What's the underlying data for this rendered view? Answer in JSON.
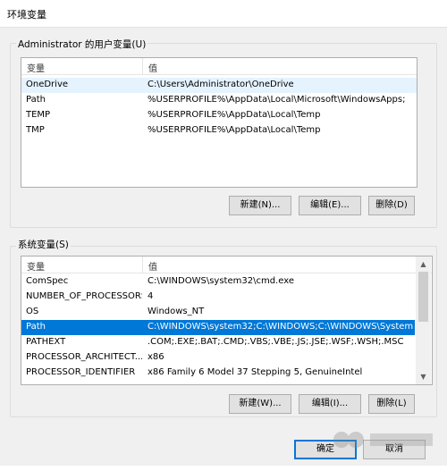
{
  "window": {
    "title": "环境变量"
  },
  "user_vars": {
    "label": "Administrator 的用户变量(U)",
    "columns": [
      "变量",
      "值"
    ],
    "rows": [
      {
        "name": "OneDrive",
        "value": "C:\\Users\\Administrator\\OneDrive"
      },
      {
        "name": "Path",
        "value": "%USERPROFILE%\\AppData\\Local\\Microsoft\\WindowsApps;"
      },
      {
        "name": "TEMP",
        "value": "%USERPROFILE%\\AppData\\Local\\Temp"
      },
      {
        "name": "TMP",
        "value": "%USERPROFILE%\\AppData\\Local\\Temp"
      }
    ],
    "buttons": {
      "new": "新建(N)...",
      "edit": "编辑(E)...",
      "delete": "删除(D)"
    }
  },
  "system_vars": {
    "label": "系统变量(S)",
    "columns": [
      "变量",
      "值"
    ],
    "rows": [
      {
        "name": "ComSpec",
        "value": "C:\\WINDOWS\\system32\\cmd.exe"
      },
      {
        "name": "NUMBER_OF_PROCESSORS",
        "value": "4"
      },
      {
        "name": "OS",
        "value": "Windows_NT"
      },
      {
        "name": "Path",
        "value": "C:\\WINDOWS\\system32;C:\\WINDOWS;C:\\WINDOWS\\System..."
      },
      {
        "name": "PATHEXT",
        "value": ".COM;.EXE;.BAT;.CMD;.VBS;.VBE;.JS;.JSE;.WSF;.WSH;.MSC"
      },
      {
        "name": "PROCESSOR_ARCHITECT...",
        "value": "x86"
      },
      {
        "name": "PROCESSOR_IDENTIFIER",
        "value": "x86 Family 6 Model 37 Stepping 5, GenuineIntel"
      }
    ],
    "selected_index": 3,
    "buttons": {
      "new": "新建(W)...",
      "edit": "编辑(I)...",
      "delete": "删除(L)"
    }
  },
  "footer": {
    "ok": "确定",
    "cancel": "取消"
  },
  "colors": {
    "selection": "#0078d7",
    "hover": "#e5f3ff",
    "background": "#f0f0f0"
  }
}
